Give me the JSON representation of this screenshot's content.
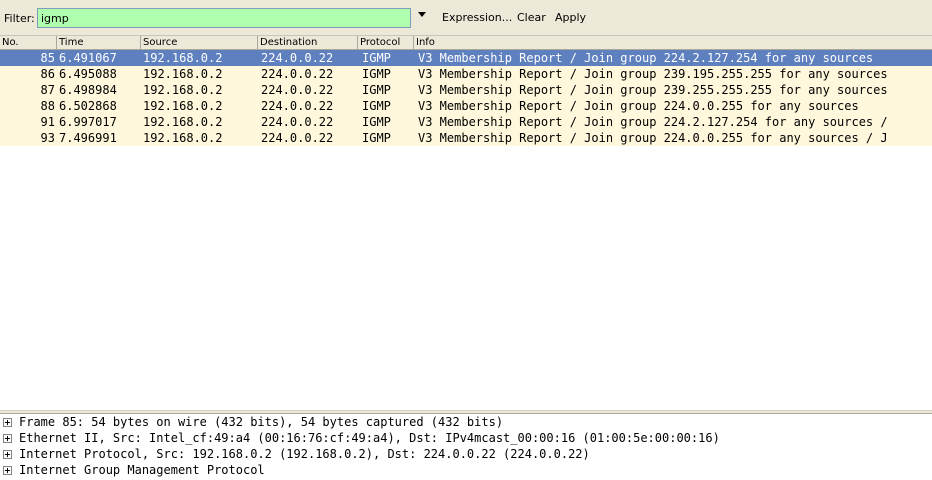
{
  "filter": {
    "label": "Filter:",
    "value": "igmp",
    "input_bg": "#afffaf",
    "expression_label": "Expression...",
    "clear_label": "Clear",
    "apply_label": "Apply"
  },
  "columns": [
    "No.",
    "Time",
    "Source",
    "Destination",
    "Protocol",
    "Info"
  ],
  "packets": [
    {
      "no": "85",
      "time": "6.491067",
      "source": "192.168.0.2",
      "destination": "224.0.0.22",
      "protocol": "IGMP",
      "info": "V3 Membership Report / Join group 224.2.127.254 for any sources",
      "selected": true
    },
    {
      "no": "86",
      "time": "6.495088",
      "source": "192.168.0.2",
      "destination": "224.0.0.22",
      "protocol": "IGMP",
      "info": "V3 Membership Report / Join group 239.195.255.255 for any sources",
      "selected": false
    },
    {
      "no": "87",
      "time": "6.498984",
      "source": "192.168.0.2",
      "destination": "224.0.0.22",
      "protocol": "IGMP",
      "info": "V3 Membership Report / Join group 239.255.255.255 for any sources",
      "selected": false
    },
    {
      "no": "88",
      "time": "6.502868",
      "source": "192.168.0.2",
      "destination": "224.0.0.22",
      "protocol": "IGMP",
      "info": "V3 Membership Report / Join group 224.0.0.255 for any sources",
      "selected": false
    },
    {
      "no": "91",
      "time": "6.997017",
      "source": "192.168.0.2",
      "destination": "224.0.0.22",
      "protocol": "IGMP",
      "info": "V3 Membership Report / Join group 224.2.127.254 for any sources /",
      "selected": false
    },
    {
      "no": "93",
      "time": "7.496991",
      "source": "192.168.0.2",
      "destination": "224.0.0.22",
      "protocol": "IGMP",
      "info": "V3 Membership Report / Join group 224.0.0.255 for any sources / J",
      "selected": false
    }
  ],
  "row_colors": {
    "igmp": "#fff8dc",
    "selected": "#5f80bf"
  },
  "details": [
    "Frame 85: 54 bytes on wire (432 bits), 54 bytes captured (432 bits)",
    "Ethernet II, Src: Intel_cf:49:a4 (00:16:76:cf:49:a4), Dst: IPv4mcast_00:00:16 (01:00:5e:00:00:16)",
    "Internet Protocol, Src: 192.168.0.2 (192.168.0.2), Dst: 224.0.0.22 (224.0.0.22)",
    "Internet Group Management Protocol"
  ],
  "icons": {
    "dropdown": "chevron-down-icon",
    "expander": "expand-plus-icon"
  }
}
